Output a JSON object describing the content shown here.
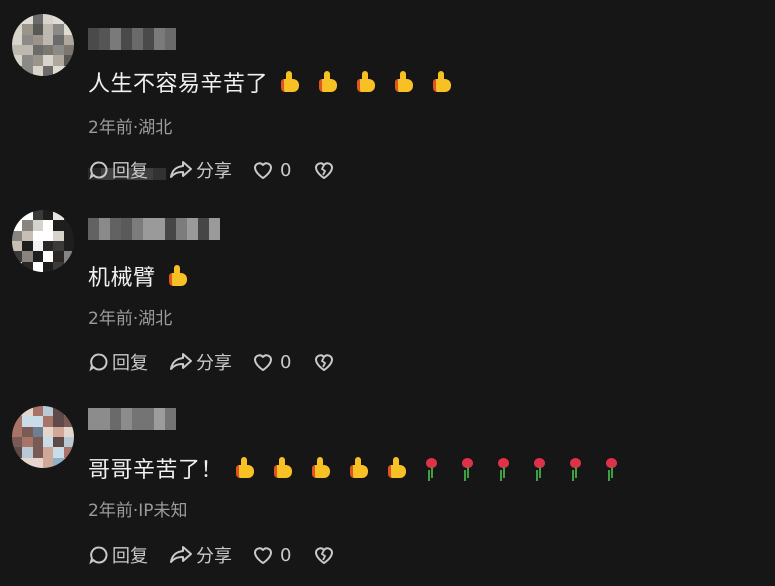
{
  "comments": [
    {
      "text": "人生不容易辛苦了",
      "emojis": [
        "thumbs-up",
        "thumbs-up",
        "thumbs-up",
        "thumbs-up",
        "thumbs-up"
      ],
      "meta": "2年前·湖北",
      "reply_label": "回复",
      "share_label": "分享",
      "like_count": "0"
    },
    {
      "text": "机械臂",
      "emojis": [
        "thumbs-up"
      ],
      "meta": "2年前·湖北",
      "reply_label": "回复",
      "share_label": "分享",
      "like_count": "0"
    },
    {
      "text": "哥哥辛苦了！",
      "emojis": [
        "thumbs-up",
        "thumbs-up",
        "thumbs-up",
        "thumbs-up",
        "thumbs-up",
        "rose",
        "rose",
        "rose",
        "rose",
        "rose",
        "rose"
      ],
      "meta": "2年前·IP未知",
      "reply_label": "回复",
      "share_label": "分享",
      "like_count": "0"
    }
  ],
  "colors": {
    "background": "#161616",
    "text_primary": "#f0f0f0",
    "text_meta": "#9b9b9b",
    "text_action": "#c9c9c9"
  }
}
